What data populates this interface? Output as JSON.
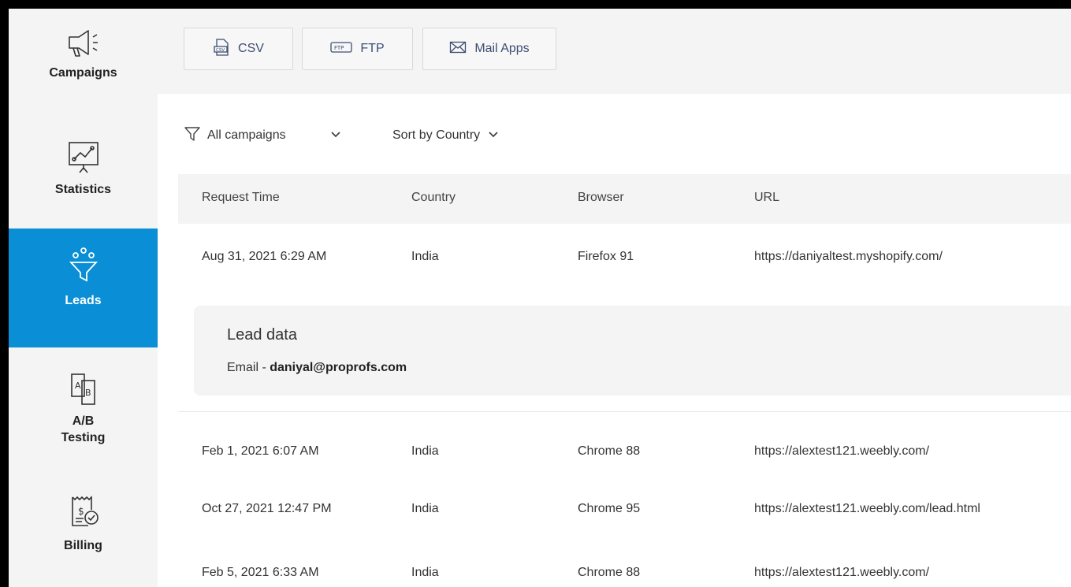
{
  "sidebar": {
    "items": [
      {
        "label": "Campaigns",
        "icon": "megaphone-icon",
        "active": false
      },
      {
        "label": "Statistics",
        "icon": "chart-presentation-icon",
        "active": false
      },
      {
        "label": "Leads",
        "icon": "funnel-icon",
        "active": true
      },
      {
        "label": "A/B\nTesting",
        "icon": "ab-test-icon",
        "active": false
      },
      {
        "label": "Billing",
        "icon": "billing-receipt-icon",
        "active": false
      }
    ]
  },
  "toolbar": {
    "csv_label": "CSV",
    "ftp_label": "FTP",
    "mail_label": "Mail Apps"
  },
  "filters": {
    "campaigns_label": "All campaigns",
    "sort_label": "Sort by Country"
  },
  "table": {
    "columns": [
      "Request Time",
      "Country",
      "Browser",
      "URL"
    ],
    "rows": [
      [
        "Aug 31, 2021 6:29 AM",
        "India",
        "Firefox 91",
        "https://daniyaltest.myshopify.com/"
      ],
      [
        "Feb 1, 2021 6:07 AM",
        "India",
        "Chrome 88",
        "https://alextest121.weebly.com/"
      ],
      [
        "Oct 27, 2021 12:47 PM",
        "India",
        "Chrome 95",
        "https://alextest121.weebly.com/lead.html"
      ],
      [
        "Feb 5, 2021 6:33 AM",
        "India",
        "Chrome 88",
        "https://alextest121.weebly.com/"
      ]
    ]
  },
  "lead_data": {
    "title": "Lead data",
    "email_prefix": "Email - ",
    "email": "daniyal@proprofs.com"
  },
  "colors": {
    "accent": "#0a8fd6",
    "sidebar_bg": "#f4f4f4",
    "button_text": "#3e4d73"
  }
}
